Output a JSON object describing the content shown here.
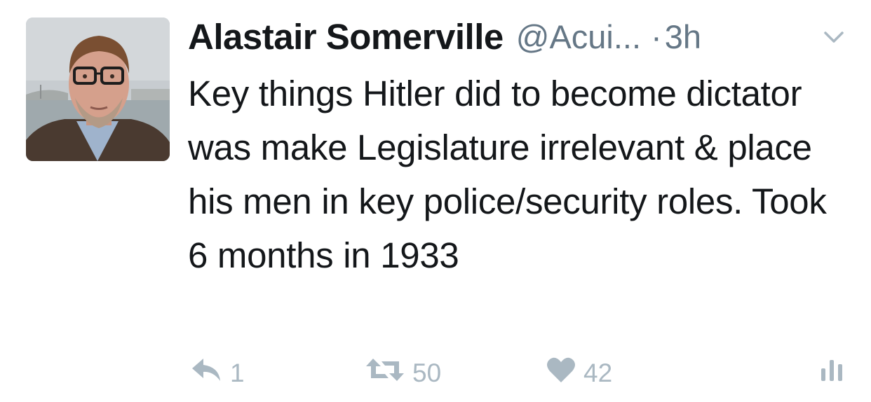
{
  "tweet": {
    "display_name": "Alastair Somerville",
    "handle": "@Acui...",
    "separator": "·",
    "time": "3h",
    "text": "Key things Hitler did to become dictator was make Legislature irrelevant & place his men in key police/security roles. Took 6 months in 1933"
  },
  "actions": {
    "reply_count": "1",
    "retweet_count": "50",
    "like_count": "42"
  },
  "colors": {
    "text": "#14171a",
    "secondary": "#657786",
    "action_icon": "#aab8c2"
  },
  "icons": [
    "chevron-down-icon",
    "reply-icon",
    "retweet-icon",
    "heart-icon",
    "analytics-icon"
  ]
}
